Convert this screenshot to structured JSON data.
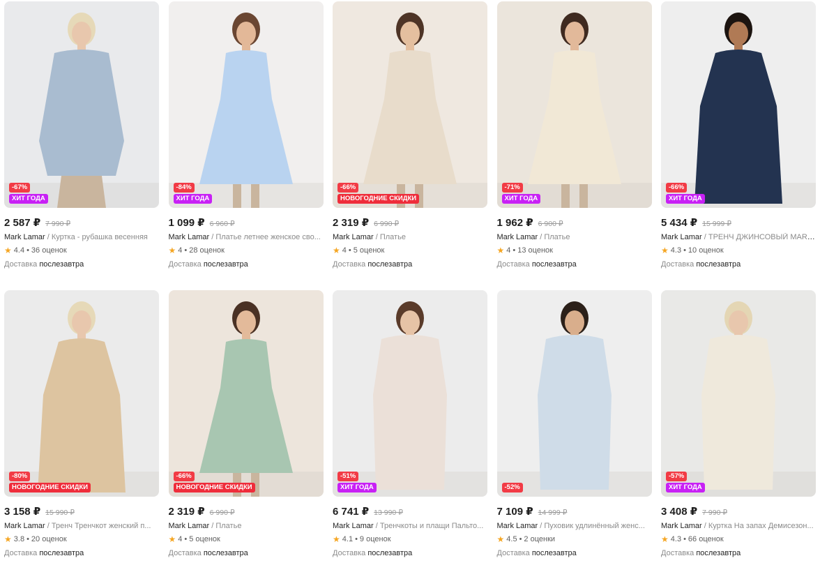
{
  "products": [
    {
      "price": "2 587 ₽",
      "old_price": "7 990 ₽",
      "brand": "Mark Lamar",
      "sep": " / ",
      "name": "Куртка - рубашка весенняя",
      "rating": "4.4",
      "reviews": "36 оценок",
      "delivery_label": "Доставка",
      "delivery_day": "послезавтра",
      "discount": "-67%",
      "promo": "ХИТ ГОДА",
      "promo_type": "hit",
      "icon": "shirt-jacket",
      "bg": "#e9eaec",
      "garment": "#a9bcd0",
      "skin": "#e8c7ad",
      "hair": "#e6d9b8"
    },
    {
      "price": "1 099 ₽",
      "old_price": "6 960 ₽",
      "brand": "Mark Lamar",
      "sep": " / ",
      "name": "Платье летнее женское сво...",
      "rating": "4",
      "reviews": "28 оценок",
      "delivery_label": "Доставка",
      "delivery_day": "послезавтра",
      "discount": "-84%",
      "promo": "ХИТ ГОДА",
      "promo_type": "hit",
      "icon": "dress",
      "bg": "#f1efee",
      "garment": "#b9d3f0",
      "skin": "#e3b898",
      "hair": "#6a4632"
    },
    {
      "price": "2 319 ₽",
      "old_price": "6 990 ₽",
      "brand": "Mark Lamar",
      "sep": " / ",
      "name": "Платье",
      "rating": "4",
      "reviews": "5 оценок",
      "delivery_label": "Доставка",
      "delivery_day": "послезавтра",
      "discount": "-66%",
      "promo": "НОВОГОДНИЕ СКИДКИ",
      "promo_type": "ny",
      "icon": "dress",
      "bg": "#efe8e0",
      "garment": "#e8dccb",
      "skin": "#e4bf9f",
      "hair": "#4e3426"
    },
    {
      "price": "1 962 ₽",
      "old_price": "6 900 ₽",
      "brand": "Mark Lamar",
      "sep": " / ",
      "name": "Платье",
      "rating": "4",
      "reviews": "13 оценок",
      "delivery_label": "Доставка",
      "delivery_day": "послезавтра",
      "discount": "-71%",
      "promo": "ХИТ ГОДА",
      "promo_type": "hit",
      "icon": "dress",
      "bg": "#ebe5dc",
      "garment": "#f1e8d6",
      "skin": "#e2b99a",
      "hair": "#3f2a20"
    },
    {
      "price": "5 434 ₽",
      "old_price": "15 999 ₽",
      "brand": "Mark Lamar",
      "sep": " / ",
      "name": "ТРЕНЧ ДЖИНСОВЫЙ MARK...",
      "rating": "4.3",
      "reviews": "10 оценок",
      "delivery_label": "Доставка",
      "delivery_day": "послезавтра",
      "discount": "-66%",
      "promo": "ХИТ ГОДА",
      "promo_type": "hit",
      "icon": "coat",
      "bg": "#eeeeee",
      "garment": "#233350",
      "skin": "#b07a55",
      "hair": "#1c1410"
    },
    {
      "price": "3 158 ₽",
      "old_price": "15 990 ₽",
      "brand": "Mark Lamar",
      "sep": " / ",
      "name": "Тренч Тренчкот женский п...",
      "rating": "3.8",
      "reviews": "20 оценок",
      "delivery_label": "Доставка",
      "delivery_day": "послезавтра",
      "discount": "-80%",
      "promo": "НОВОГОДНИЕ СКИДКИ",
      "promo_type": "ny",
      "icon": "coat",
      "bg": "#ebebeb",
      "garment": "#ddc4a0",
      "skin": "#e8c7ad",
      "hair": "#e6d9b8"
    },
    {
      "price": "2 319 ₽",
      "old_price": "6 990 ₽",
      "brand": "Mark Lamar",
      "sep": " / ",
      "name": "Платье",
      "rating": "4",
      "reviews": "5 оценок",
      "delivery_label": "Доставка",
      "delivery_day": "послезавтра",
      "discount": "-66%",
      "promo": "НОВОГОДНИЕ СКИДКИ",
      "promo_type": "ny",
      "icon": "dress",
      "bg": "#ede5dc",
      "garment": "#a8c6b1",
      "skin": "#e3ba9a",
      "hair": "#4a3124"
    },
    {
      "price": "6 741 ₽",
      "old_price": "13 990 ₽",
      "brand": "Mark Lamar",
      "sep": " / ",
      "name": "Тренчкоты и плащи Пальто...",
      "rating": "4.1",
      "reviews": "9 оценок",
      "delivery_label": "Доставка",
      "delivery_day": "послезавтра",
      "discount": "-51%",
      "promo": "ХИТ ГОДА",
      "promo_type": "hit",
      "icon": "puffer",
      "bg": "#ececec",
      "garment": "#ebe0d8",
      "skin": "#e6c3a6",
      "hair": "#5a3b2a"
    },
    {
      "price": "7 109 ₽",
      "old_price": "14 999 ₽",
      "brand": "Mark Lamar",
      "sep": " / ",
      "name": "Пуховик удлинённый женс...",
      "rating": "4.5",
      "reviews": "2 оценки",
      "delivery_label": "Доставка",
      "delivery_day": "послезавтра",
      "discount": "-52%",
      "promo": "",
      "promo_type": "",
      "icon": "puffer",
      "bg": "#eeeeee",
      "garment": "#cfdce8",
      "skin": "#d9ae8c",
      "hair": "#2b2019"
    },
    {
      "price": "3 408 ₽",
      "old_price": "7 990 ₽",
      "brand": "Mark Lamar",
      "sep": " / ",
      "name": "Куртка На запах Демисезон...",
      "rating": "4.3",
      "reviews": "66 оценок",
      "delivery_label": "Доставка",
      "delivery_day": "послезавтра",
      "discount": "-57%",
      "promo": "ХИТ ГОДА",
      "promo_type": "hit",
      "icon": "puffer",
      "bg": "#e9e9e7",
      "garment": "#efe9dc",
      "skin": "#e8c7ad",
      "hair": "#e4d6b4"
    }
  ]
}
